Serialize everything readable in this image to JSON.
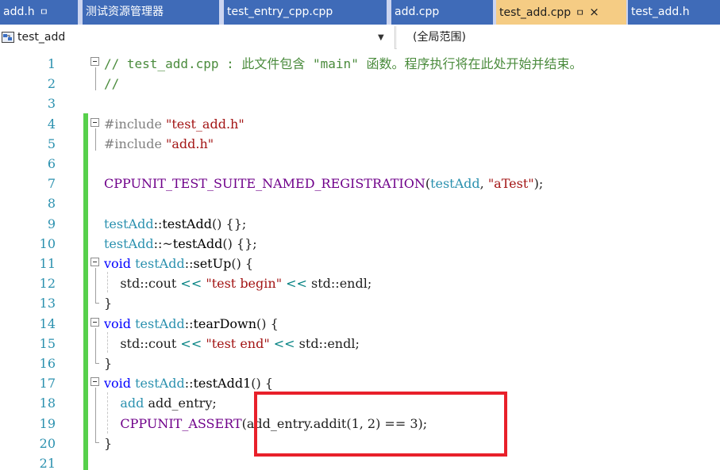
{
  "colors": {
    "tab_bar_background": "#ccd5f0",
    "tab_background": "#3f6bb8",
    "active_tab_background": "#f5cc84",
    "line_number_color": "#2b91af",
    "change_bar_color": "#57d04b",
    "highlight_border": "#e8202a"
  },
  "icons": {
    "pin": "pin-icon",
    "close": "close-icon",
    "project": "project-icon",
    "dropdown": "chevron-down-icon"
  },
  "tabs": [
    {
      "label": "add.h",
      "pin": "ㅁ",
      "active": false
    },
    {
      "label": "测试资源管理器",
      "active": false
    },
    {
      "label": "test_entry_cpp.cpp",
      "active": false
    },
    {
      "label": "add.cpp",
      "active": false
    },
    {
      "label": "test_add.cpp",
      "pin": "ㅁ",
      "close": "×",
      "active": true
    },
    {
      "label": "test_add.h",
      "active": false
    }
  ],
  "navigation": {
    "project_label": "test_add",
    "dropdown_glyph": "▼",
    "scope_label": "(全局范围)"
  },
  "editor": {
    "line_numbers": [
      "1",
      "2",
      "3",
      "4",
      "5",
      "6",
      "7",
      "8",
      "9",
      "10",
      "11",
      "12",
      "13",
      "14",
      "15",
      "16",
      "17",
      "18",
      "19",
      "20",
      "21"
    ],
    "lines": [
      [
        {
          "t": "// test_add.cpp : 此文件包含 \"main\" 函数。程序执行将在此处开始并结束。",
          "c": "c"
        }
      ],
      [
        {
          "t": "//",
          "c": "c"
        }
      ],
      [],
      [
        {
          "t": "#include ",
          "c": "pp"
        },
        {
          "t": "\"test_add.h\"",
          "c": "s"
        }
      ],
      [
        {
          "t": "#include ",
          "c": "pp"
        },
        {
          "t": "\"add.h\"",
          "c": "s"
        }
      ],
      [],
      [
        {
          "t": "CPPUNIT_TEST_SUITE_NAMED_REGISTRATION",
          "c": "m"
        },
        {
          "t": "(",
          "c": ""
        },
        {
          "t": "testAdd",
          "c": "t"
        },
        {
          "t": ", ",
          "c": ""
        },
        {
          "t": "\"aTest\"",
          "c": "s"
        },
        {
          "t": ");",
          "c": ""
        }
      ],
      [],
      [
        {
          "t": "testAdd",
          "c": "t"
        },
        {
          "t": "::",
          "c": ""
        },
        {
          "t": "testAdd",
          "c": "f"
        },
        {
          "t": "() {};",
          "c": ""
        }
      ],
      [
        {
          "t": "testAdd",
          "c": "t"
        },
        {
          "t": "::~",
          "c": ""
        },
        {
          "t": "testAdd",
          "c": "f"
        },
        {
          "t": "() {};",
          "c": ""
        }
      ],
      [
        {
          "t": "void ",
          "c": "k"
        },
        {
          "t": "testAdd",
          "c": "t"
        },
        {
          "t": "::",
          "c": ""
        },
        {
          "t": "setUp",
          "c": "f"
        },
        {
          "t": "() {",
          "c": ""
        }
      ],
      [
        {
          "t": "    std",
          "c": ""
        },
        {
          "t": "::",
          "c": ""
        },
        {
          "t": "cout",
          "c": ""
        },
        {
          "t": " << ",
          "c": "o"
        },
        {
          "t": "\"test begin\"",
          "c": "s"
        },
        {
          "t": " << ",
          "c": "o"
        },
        {
          "t": "std::endl;",
          "c": ""
        }
      ],
      [
        {
          "t": "}",
          "c": ""
        }
      ],
      [
        {
          "t": "void ",
          "c": "k"
        },
        {
          "t": "testAdd",
          "c": "t"
        },
        {
          "t": "::",
          "c": ""
        },
        {
          "t": "tearDown",
          "c": "f"
        },
        {
          "t": "() {",
          "c": ""
        }
      ],
      [
        {
          "t": "    std",
          "c": ""
        },
        {
          "t": "::",
          "c": ""
        },
        {
          "t": "cout",
          "c": ""
        },
        {
          "t": " << ",
          "c": "o"
        },
        {
          "t": "\"test end\"",
          "c": "s"
        },
        {
          "t": " << ",
          "c": "o"
        },
        {
          "t": "std::endl;",
          "c": ""
        }
      ],
      [
        {
          "t": "}",
          "c": ""
        }
      ],
      [
        {
          "t": "void ",
          "c": "k"
        },
        {
          "t": "testAdd",
          "c": "t"
        },
        {
          "t": "::",
          "c": ""
        },
        {
          "t": "testAdd1",
          "c": "f"
        },
        {
          "t": "() {",
          "c": ""
        }
      ],
      [
        {
          "t": "    add ",
          "c": "t"
        },
        {
          "t": "add_entry;",
          "c": ""
        }
      ],
      [
        {
          "t": "    CPPUNIT_ASSERT",
          "c": "m"
        },
        {
          "t": "(",
          "c": ""
        },
        {
          "t": "add_entry.addit(1, 2) == 3);",
          "c": ""
        }
      ],
      [
        {
          "t": "}",
          "c": ""
        }
      ],
      []
    ]
  }
}
